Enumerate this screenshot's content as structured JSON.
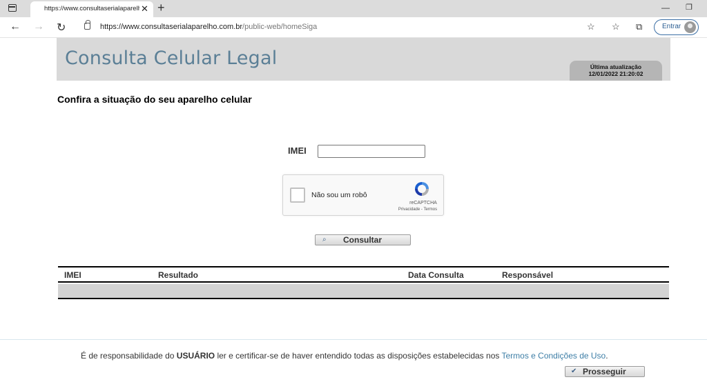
{
  "browser": {
    "tab_title": "https://www.consultaserialaparelho.com.br/public-web/homeSiga",
    "url_host": "https://www.consultaserialaparelho.com.br",
    "url_path": "/public-web/homeSiga",
    "signin_label": "Entrar"
  },
  "header": {
    "title": "Consulta Celular Legal",
    "update_label": "Última atualização",
    "update_date": "12/01/2022 21:20:02"
  },
  "main": {
    "subtitle": "Confira a situação do seu aparelho celular",
    "imei_label": "IMEI",
    "imei_value": "",
    "captcha_label": "Não sou um robô",
    "captcha_brand": "reCAPTCHA",
    "captcha_links": "Privacidade - Termos",
    "consult_label": "Consultar"
  },
  "table": {
    "columns": [
      "IMEI",
      "Resultado",
      "Data Consulta",
      "Responsável"
    ]
  },
  "footer": {
    "text_before": "É de responsabilidade do ",
    "text_bold": "USUÁRIO",
    "text_after": " ler e certificar-se de haver entendido todas as disposições estabelecidas nos ",
    "link": "Termos e Condições de Uso",
    "text_end": ".",
    "proceed_label": "Prosseguir"
  },
  "colors": {
    "header_bg": "#d9d9d9",
    "title_color": "#5b7f96",
    "link_color": "#3d7ea6"
  }
}
